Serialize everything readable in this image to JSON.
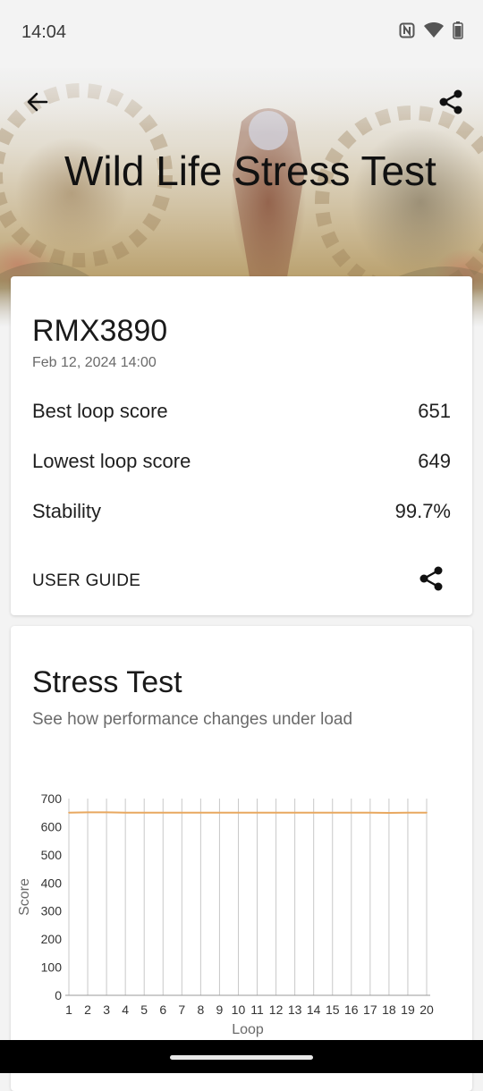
{
  "status_bar": {
    "time": "14:04",
    "icons": [
      "nfc-icon",
      "wifi-icon",
      "battery-icon"
    ]
  },
  "header": {
    "title": "Wild Life Stress Test",
    "back_icon": "back-arrow-icon",
    "share_icon": "share-icon"
  },
  "summary": {
    "device": "RMX3890",
    "date": "Feb 12, 2024 14:00",
    "rows": [
      {
        "label": "Best loop score",
        "value": "651"
      },
      {
        "label": "Lowest loop score",
        "value": "649"
      },
      {
        "label": "Stability",
        "value": "99.7%"
      }
    ],
    "user_guide": "USER GUIDE"
  },
  "stress_test": {
    "title": "Stress Test",
    "subtitle": "See how performance changes under load"
  },
  "chart_data": {
    "type": "line",
    "x": [
      1,
      2,
      3,
      4,
      5,
      6,
      7,
      8,
      9,
      10,
      11,
      12,
      13,
      14,
      15,
      16,
      17,
      18,
      19,
      20
    ],
    "series": [
      {
        "values": [
          650,
          651,
          651,
          650,
          650,
          650,
          650,
          650,
          650,
          650,
          650,
          650,
          650,
          650,
          650,
          650,
          650,
          649,
          650,
          650
        ]
      }
    ],
    "xlabel": "Loop",
    "ylabel": "Score",
    "ylim": [
      0,
      700
    ],
    "yticks": [
      0,
      100,
      200,
      300,
      400,
      500,
      600,
      700
    ],
    "line_color": "#e8a860",
    "grid": "vertical"
  },
  "colors": {
    "accent_line": "#e8a860",
    "text_primary": "#1f1f1f",
    "text_secondary": "#6a6a6a"
  }
}
